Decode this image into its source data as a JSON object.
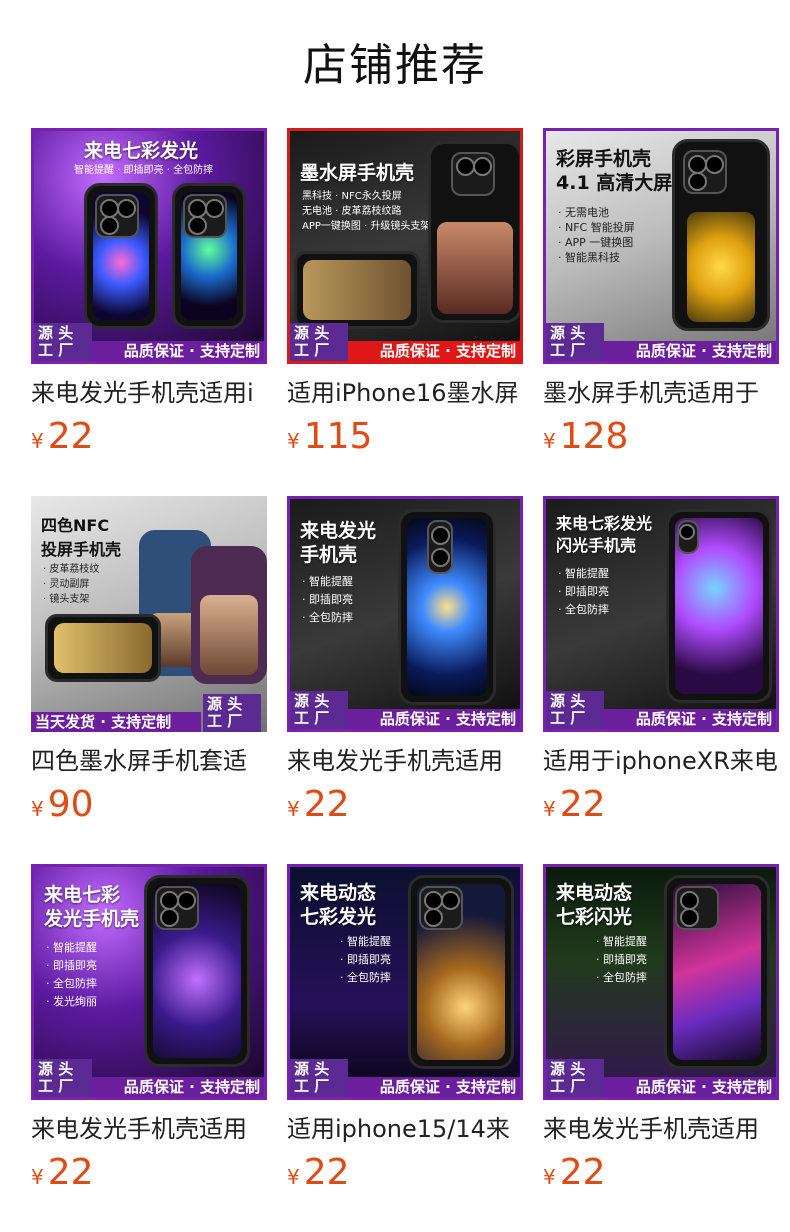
{
  "page": {
    "title": "店铺推荐"
  },
  "colors": {
    "accent_price": "#e04a14",
    "border_purple": "#7a1fb0",
    "border_red": "#d71a1a"
  },
  "products": [
    {
      "name": "来电发光手机壳适用i",
      "currency": "¥",
      "price": "22",
      "image_text": {
        "headline": "来电七彩发光",
        "sub": "智能提醒 · 即插即亮 · 全包防摔",
        "badge": "源 头\n工 厂",
        "banner": "品质保证 · 支持定制"
      }
    },
    {
      "name": "适用iPhone16墨水屏",
      "currency": "¥",
      "price": "115",
      "image_text": {
        "headline": "墨水屏手机壳",
        "sub": "黑科技 · NFC永久投屏\n无电池 · 皮革荔枝纹路\nAPP一键换图 · 升级镜头支架",
        "badge": "源 头\n工 厂",
        "banner": "品质保证 · 支持定制"
      }
    },
    {
      "name": "墨水屏手机壳适用于",
      "currency": "¥",
      "price": "128",
      "image_text": {
        "headline": "彩屏手机壳\n4.1 高清大屏",
        "sub": "· 无需电池\n· NFC 智能投屏\n· APP 一键换图\n· 智能黑科技",
        "badge": "源 头\n工 厂",
        "banner": "品质保证 · 支持定制"
      }
    },
    {
      "name": "四色墨水屏手机套适",
      "currency": "¥",
      "price": "90",
      "image_text": {
        "headline": "四色NFC\n投屏手机壳",
        "sub": "· 皮革荔枝纹\n· 灵动副屏\n· 镜头支架",
        "badge": "源 头\n工 厂",
        "banner": "当天发货 · 支持定制"
      }
    },
    {
      "name": "来电发光手机壳适用",
      "currency": "¥",
      "price": "22",
      "image_text": {
        "headline": "来电发光\n手机壳",
        "sub": "· 智能提醒\n· 即插即亮\n· 全包防摔",
        "badge": "源 头\n工 厂",
        "banner": "品质保证 · 支持定制"
      }
    },
    {
      "name": "适用于iphoneXR来电",
      "currency": "¥",
      "price": "22",
      "image_text": {
        "headline": "来电七彩发光\n闪光手机壳",
        "sub": "· 智能提醒\n· 即插即亮\n· 全包防摔",
        "badge": "源 头\n工 厂",
        "banner": "品质保证 · 支持定制"
      }
    },
    {
      "name": "来电发光手机壳适用",
      "currency": "¥",
      "price": "22",
      "image_text": {
        "headline": "来电七彩\n发光手机壳",
        "sub": "· 智能提醒\n· 即插即亮\n· 全包防摔\n· 发光绚丽",
        "badge": "源 头\n工 厂",
        "banner": "品质保证 · 支持定制"
      }
    },
    {
      "name": "适用iphone15/14来",
      "currency": "¥",
      "price": "22",
      "image_text": {
        "headline": "来电动态\n七彩发光",
        "sub": "· 智能提醒\n· 即插即亮\n· 全包防摔",
        "badge": "源 头\n工 厂",
        "banner": "品质保证 · 支持定制"
      }
    },
    {
      "name": "来电发光手机壳适用",
      "currency": "¥",
      "price": "22",
      "image_text": {
        "headline": "来电动态\n七彩闪光",
        "sub": "· 智能提醒\n· 即插即亮\n· 全包防摔",
        "badge": "源 头\n工 厂",
        "banner": "品质保证 · 支持定制"
      }
    }
  ]
}
